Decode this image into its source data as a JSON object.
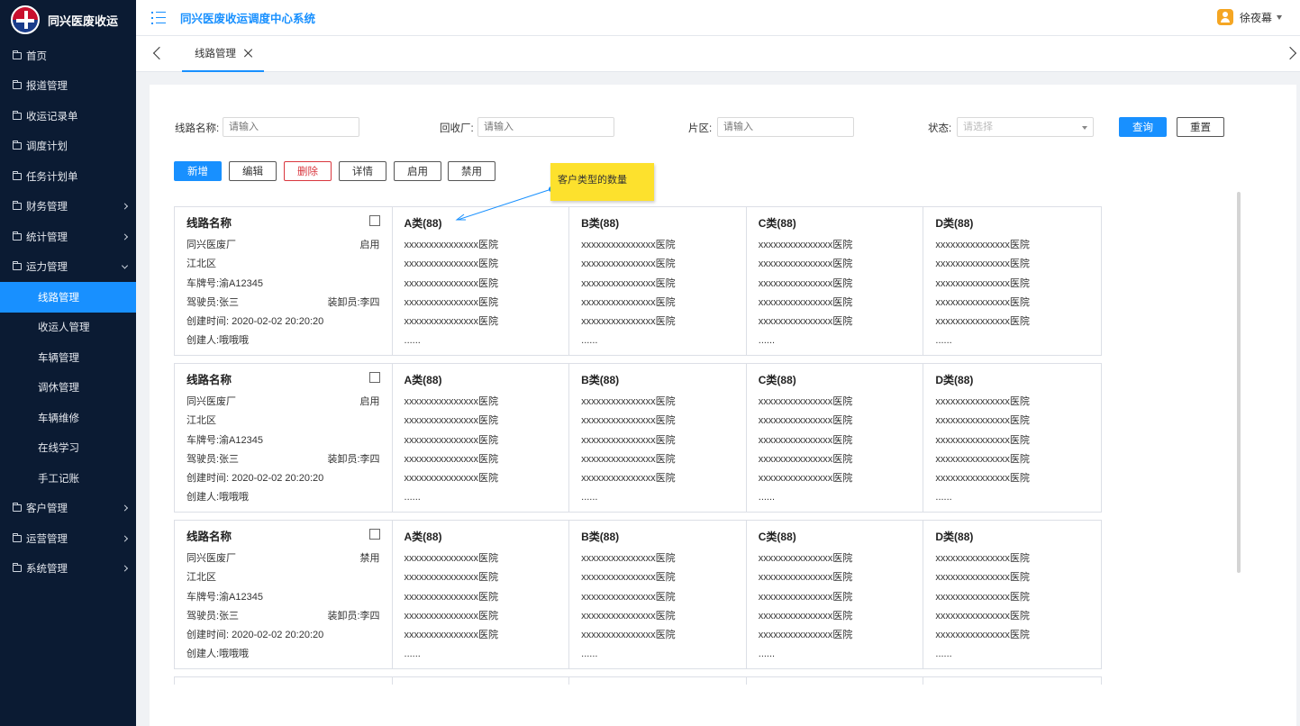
{
  "brand": {
    "name": "同兴医废收运"
  },
  "header": {
    "system_title": "同兴医废收运调度中心系统",
    "username": "徐夜幕"
  },
  "sidebar": {
    "items": [
      {
        "label": "首页",
        "chevron": "none"
      },
      {
        "label": "报道管理",
        "chevron": "none"
      },
      {
        "label": "收运记录单",
        "chevron": "none"
      },
      {
        "label": "调度计划",
        "chevron": "none"
      },
      {
        "label": "任务计划单",
        "chevron": "none"
      },
      {
        "label": "财务管理",
        "chevron": "right"
      },
      {
        "label": "统计管理",
        "chevron": "right"
      },
      {
        "label": "运力管理",
        "chevron": "down"
      }
    ],
    "sub_items": [
      {
        "label": "线路管理",
        "active": true
      },
      {
        "label": "收运人管理"
      },
      {
        "label": "车辆管理"
      },
      {
        "label": "调休管理"
      },
      {
        "label": "车辆维修"
      },
      {
        "label": "在线学习"
      },
      {
        "label": "手工记账"
      }
    ],
    "items_after": [
      {
        "label": "客户管理",
        "chevron": "right"
      },
      {
        "label": "运营管理",
        "chevron": "right"
      },
      {
        "label": "系统管理",
        "chevron": "right"
      }
    ]
  },
  "tabs": [
    {
      "label": "线路管理"
    }
  ],
  "search": {
    "route_name_label": "线路名称:",
    "route_name_placeholder": "请输入",
    "plant_label": "回收厂:",
    "plant_placeholder": "请输入",
    "district_label": "片区:",
    "district_placeholder": "请输入",
    "status_label": "状态:",
    "status_placeholder": "请选择",
    "query_label": "查询",
    "reset_label": "重置"
  },
  "toolbar": {
    "add": "新增",
    "edit": "编辑",
    "delete": "删除",
    "detail": "详情",
    "enable": "启用",
    "disable": "禁用"
  },
  "annotation": {
    "text": "客户类型的数量"
  },
  "cards": [
    {
      "title": "线路名称",
      "plant": "同兴医废厂",
      "status": "启用",
      "district": "江北区",
      "plate": "车牌号:渝A12345",
      "driver": "驾驶员:张三",
      "loader": "装卸员:李四",
      "created": "创建时间: 2020-02-02 20:20:20",
      "creator": "创建人:哦哦哦",
      "categories": [
        {
          "title": "A类(88)",
          "hospitals": [
            "xxxxxxxxxxxxxxx医院",
            "xxxxxxxxxxxxxxx医院",
            "xxxxxxxxxxxxxxx医院",
            "xxxxxxxxxxxxxxx医院",
            "xxxxxxxxxxxxxxx医院"
          ],
          "more": "......"
        },
        {
          "title": "B类(88)",
          "hospitals": [
            "xxxxxxxxxxxxxxx医院",
            "xxxxxxxxxxxxxxx医院",
            "xxxxxxxxxxxxxxx医院",
            "xxxxxxxxxxxxxxx医院",
            "xxxxxxxxxxxxxxx医院"
          ],
          "more": "......"
        },
        {
          "title": "C类(88)",
          "hospitals": [
            "xxxxxxxxxxxxxxx医院",
            "xxxxxxxxxxxxxxx医院",
            "xxxxxxxxxxxxxxx医院",
            "xxxxxxxxxxxxxxx医院",
            "xxxxxxxxxxxxxxx医院"
          ],
          "more": "......"
        },
        {
          "title": "D类(88)",
          "hospitals": [
            "xxxxxxxxxxxxxxx医院",
            "xxxxxxxxxxxxxxx医院",
            "xxxxxxxxxxxxxxx医院",
            "xxxxxxxxxxxxxxx医院",
            "xxxxxxxxxxxxxxx医院"
          ],
          "more": "......"
        }
      ]
    },
    {
      "title": "线路名称",
      "plant": "同兴医废厂",
      "status": "启用",
      "district": "江北区",
      "plate": "车牌号:渝A12345",
      "driver": "驾驶员:张三",
      "loader": "装卸员:李四",
      "created": "创建时间: 2020-02-02 20:20:20",
      "creator": "创建人:哦哦哦",
      "categories": [
        {
          "title": "A类(88)",
          "hospitals": [
            "xxxxxxxxxxxxxxx医院",
            "xxxxxxxxxxxxxxx医院",
            "xxxxxxxxxxxxxxx医院",
            "xxxxxxxxxxxxxxx医院",
            "xxxxxxxxxxxxxxx医院"
          ],
          "more": "......"
        },
        {
          "title": "B类(88)",
          "hospitals": [
            "xxxxxxxxxxxxxxx医院",
            "xxxxxxxxxxxxxxx医院",
            "xxxxxxxxxxxxxxx医院",
            "xxxxxxxxxxxxxxx医院",
            "xxxxxxxxxxxxxxx医院"
          ],
          "more": "......"
        },
        {
          "title": "C类(88)",
          "hospitals": [
            "xxxxxxxxxxxxxxx医院",
            "xxxxxxxxxxxxxxx医院",
            "xxxxxxxxxxxxxxx医院",
            "xxxxxxxxxxxxxxx医院",
            "xxxxxxxxxxxxxxx医院"
          ],
          "more": "......"
        },
        {
          "title": "D类(88)",
          "hospitals": [
            "xxxxxxxxxxxxxxx医院",
            "xxxxxxxxxxxxxxx医院",
            "xxxxxxxxxxxxxxx医院",
            "xxxxxxxxxxxxxxx医院",
            "xxxxxxxxxxxxxxx医院"
          ],
          "more": "......"
        }
      ]
    },
    {
      "title": "线路名称",
      "plant": "同兴医废厂",
      "status": "禁用",
      "district": "江北区",
      "plate": "车牌号:渝A12345",
      "driver": "驾驶员:张三",
      "loader": "装卸员:李四",
      "created": "创建时间: 2020-02-02 20:20:20",
      "creator": "创建人:哦哦哦",
      "categories": [
        {
          "title": "A类(88)",
          "hospitals": [
            "xxxxxxxxxxxxxxx医院",
            "xxxxxxxxxxxxxxx医院",
            "xxxxxxxxxxxxxxx医院",
            "xxxxxxxxxxxxxxx医院",
            "xxxxxxxxxxxxxxx医院"
          ],
          "more": "......"
        },
        {
          "title": "B类(88)",
          "hospitals": [
            "xxxxxxxxxxxxxxx医院",
            "xxxxxxxxxxxxxxx医院",
            "xxxxxxxxxxxxxxx医院",
            "xxxxxxxxxxxxxxx医院",
            "xxxxxxxxxxxxxxx医院"
          ],
          "more": "......"
        },
        {
          "title": "C类(88)",
          "hospitals": [
            "xxxxxxxxxxxxxxx医院",
            "xxxxxxxxxxxxxxx医院",
            "xxxxxxxxxxxxxxx医院",
            "xxxxxxxxxxxxxxx医院",
            "xxxxxxxxxxxxxxx医院"
          ],
          "more": "......"
        },
        {
          "title": "D类(88)",
          "hospitals": [
            "xxxxxxxxxxxxxxx医院",
            "xxxxxxxxxxxxxxx医院",
            "xxxxxxxxxxxxxxx医院",
            "xxxxxxxxxxxxxxx医院",
            "xxxxxxxxxxxxxxx医院"
          ],
          "more": "......"
        }
      ]
    }
  ],
  "colors": {
    "primary": "#1890ff",
    "sidebar_bg": "#0b1b33",
    "danger": "#d9363e",
    "note": "#fde12d"
  }
}
